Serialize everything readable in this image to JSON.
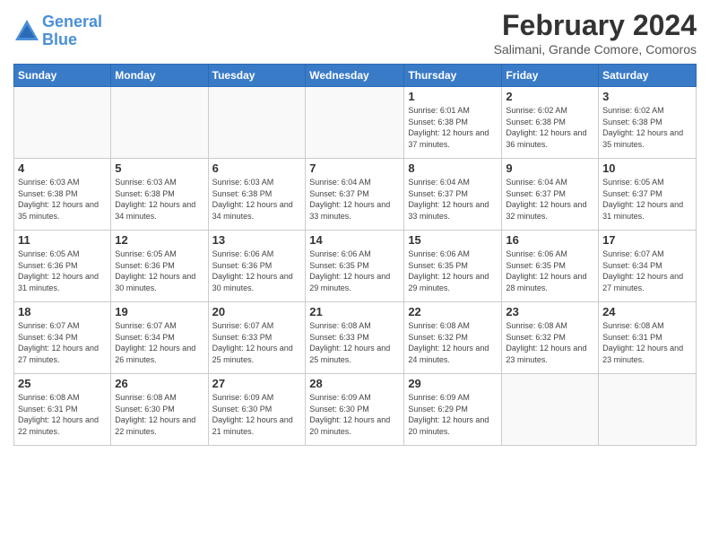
{
  "header": {
    "logo_line1": "General",
    "logo_line2": "Blue",
    "month_title": "February 2024",
    "subtitle": "Salimani, Grande Comore, Comoros"
  },
  "days_of_week": [
    "Sunday",
    "Monday",
    "Tuesday",
    "Wednesday",
    "Thursday",
    "Friday",
    "Saturday"
  ],
  "weeks": [
    [
      {
        "day": "",
        "info": ""
      },
      {
        "day": "",
        "info": ""
      },
      {
        "day": "",
        "info": ""
      },
      {
        "day": "",
        "info": ""
      },
      {
        "day": "1",
        "info": "Sunrise: 6:01 AM\nSunset: 6:38 PM\nDaylight: 12 hours and 37 minutes."
      },
      {
        "day": "2",
        "info": "Sunrise: 6:02 AM\nSunset: 6:38 PM\nDaylight: 12 hours and 36 minutes."
      },
      {
        "day": "3",
        "info": "Sunrise: 6:02 AM\nSunset: 6:38 PM\nDaylight: 12 hours and 35 minutes."
      }
    ],
    [
      {
        "day": "4",
        "info": "Sunrise: 6:03 AM\nSunset: 6:38 PM\nDaylight: 12 hours and 35 minutes."
      },
      {
        "day": "5",
        "info": "Sunrise: 6:03 AM\nSunset: 6:38 PM\nDaylight: 12 hours and 34 minutes."
      },
      {
        "day": "6",
        "info": "Sunrise: 6:03 AM\nSunset: 6:38 PM\nDaylight: 12 hours and 34 minutes."
      },
      {
        "day": "7",
        "info": "Sunrise: 6:04 AM\nSunset: 6:37 PM\nDaylight: 12 hours and 33 minutes."
      },
      {
        "day": "8",
        "info": "Sunrise: 6:04 AM\nSunset: 6:37 PM\nDaylight: 12 hours and 33 minutes."
      },
      {
        "day": "9",
        "info": "Sunrise: 6:04 AM\nSunset: 6:37 PM\nDaylight: 12 hours and 32 minutes."
      },
      {
        "day": "10",
        "info": "Sunrise: 6:05 AM\nSunset: 6:37 PM\nDaylight: 12 hours and 31 minutes."
      }
    ],
    [
      {
        "day": "11",
        "info": "Sunrise: 6:05 AM\nSunset: 6:36 PM\nDaylight: 12 hours and 31 minutes."
      },
      {
        "day": "12",
        "info": "Sunrise: 6:05 AM\nSunset: 6:36 PM\nDaylight: 12 hours and 30 minutes."
      },
      {
        "day": "13",
        "info": "Sunrise: 6:06 AM\nSunset: 6:36 PM\nDaylight: 12 hours and 30 minutes."
      },
      {
        "day": "14",
        "info": "Sunrise: 6:06 AM\nSunset: 6:35 PM\nDaylight: 12 hours and 29 minutes."
      },
      {
        "day": "15",
        "info": "Sunrise: 6:06 AM\nSunset: 6:35 PM\nDaylight: 12 hours and 29 minutes."
      },
      {
        "day": "16",
        "info": "Sunrise: 6:06 AM\nSunset: 6:35 PM\nDaylight: 12 hours and 28 minutes."
      },
      {
        "day": "17",
        "info": "Sunrise: 6:07 AM\nSunset: 6:34 PM\nDaylight: 12 hours and 27 minutes."
      }
    ],
    [
      {
        "day": "18",
        "info": "Sunrise: 6:07 AM\nSunset: 6:34 PM\nDaylight: 12 hours and 27 minutes."
      },
      {
        "day": "19",
        "info": "Sunrise: 6:07 AM\nSunset: 6:34 PM\nDaylight: 12 hours and 26 minutes."
      },
      {
        "day": "20",
        "info": "Sunrise: 6:07 AM\nSunset: 6:33 PM\nDaylight: 12 hours and 25 minutes."
      },
      {
        "day": "21",
        "info": "Sunrise: 6:08 AM\nSunset: 6:33 PM\nDaylight: 12 hours and 25 minutes."
      },
      {
        "day": "22",
        "info": "Sunrise: 6:08 AM\nSunset: 6:32 PM\nDaylight: 12 hours and 24 minutes."
      },
      {
        "day": "23",
        "info": "Sunrise: 6:08 AM\nSunset: 6:32 PM\nDaylight: 12 hours and 23 minutes."
      },
      {
        "day": "24",
        "info": "Sunrise: 6:08 AM\nSunset: 6:31 PM\nDaylight: 12 hours and 23 minutes."
      }
    ],
    [
      {
        "day": "25",
        "info": "Sunrise: 6:08 AM\nSunset: 6:31 PM\nDaylight: 12 hours and 22 minutes."
      },
      {
        "day": "26",
        "info": "Sunrise: 6:08 AM\nSunset: 6:30 PM\nDaylight: 12 hours and 22 minutes."
      },
      {
        "day": "27",
        "info": "Sunrise: 6:09 AM\nSunset: 6:30 PM\nDaylight: 12 hours and 21 minutes."
      },
      {
        "day": "28",
        "info": "Sunrise: 6:09 AM\nSunset: 6:30 PM\nDaylight: 12 hours and 20 minutes."
      },
      {
        "day": "29",
        "info": "Sunrise: 6:09 AM\nSunset: 6:29 PM\nDaylight: 12 hours and 20 minutes."
      },
      {
        "day": "",
        "info": ""
      },
      {
        "day": "",
        "info": ""
      }
    ]
  ]
}
